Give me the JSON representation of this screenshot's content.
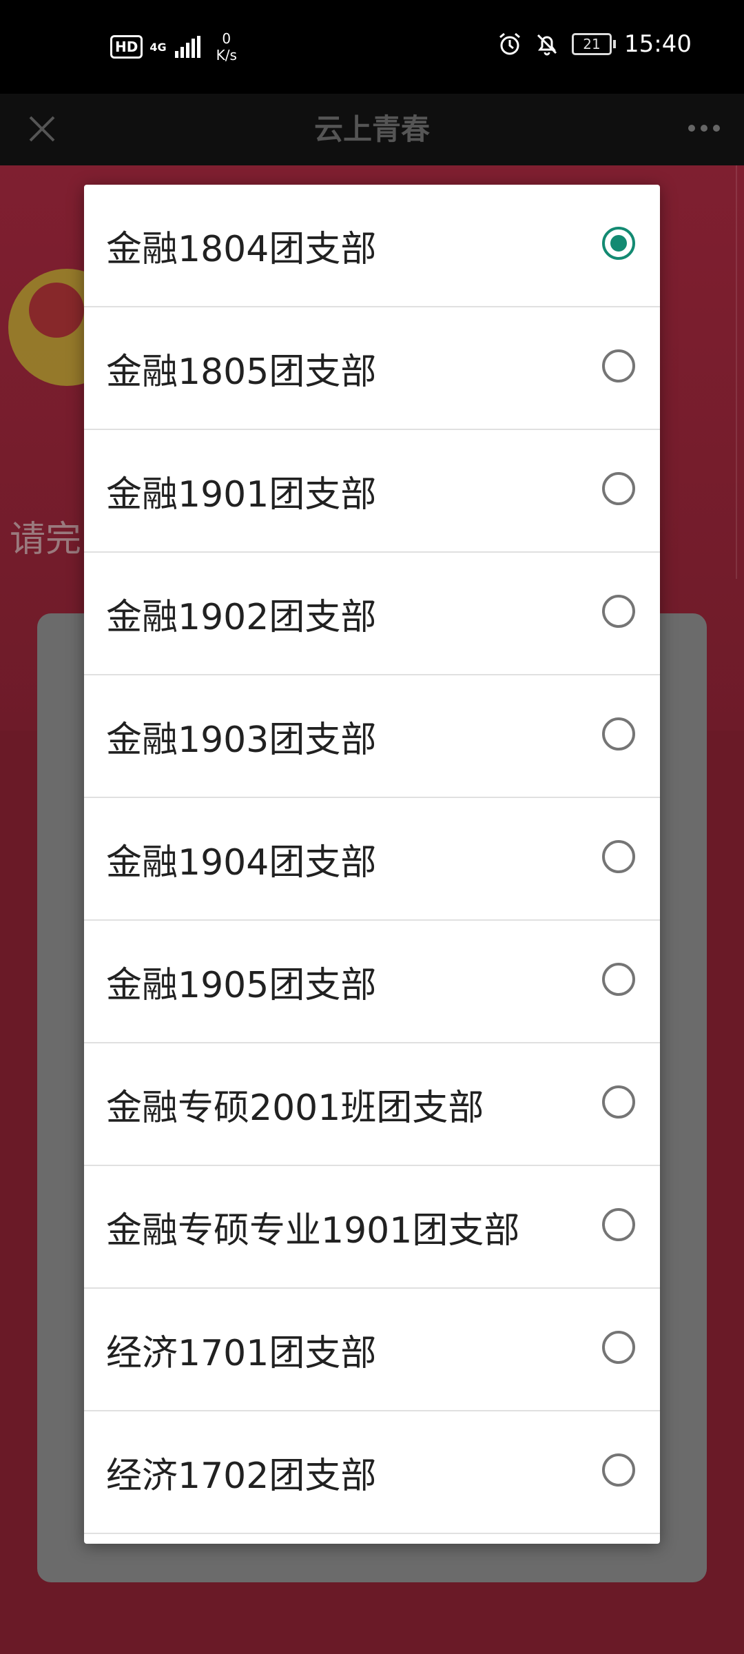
{
  "status_bar": {
    "hd": "HD",
    "network": "4G",
    "speed_value": "0",
    "speed_unit": "K/s",
    "battery": "21",
    "time": "15:40"
  },
  "title_bar": {
    "title": "云上青春"
  },
  "background": {
    "hint_text": "请完"
  },
  "dialog": {
    "selected_index": 0,
    "accent_color": "#138a72",
    "options": [
      {
        "label": "金融1804团支部",
        "checked": true
      },
      {
        "label": "金融1805团支部",
        "checked": false
      },
      {
        "label": "金融1901团支部",
        "checked": false
      },
      {
        "label": "金融1902团支部",
        "checked": false
      },
      {
        "label": "金融1903团支部",
        "checked": false
      },
      {
        "label": "金融1904团支部",
        "checked": false
      },
      {
        "label": "金融1905团支部",
        "checked": false
      },
      {
        "label": "金融专硕2001班团支部",
        "checked": false
      },
      {
        "label": "金融专硕专业1901团支部",
        "checked": false
      },
      {
        "label": "经济1701团支部",
        "checked": false
      },
      {
        "label": "经济1702团支部",
        "checked": false
      }
    ]
  }
}
